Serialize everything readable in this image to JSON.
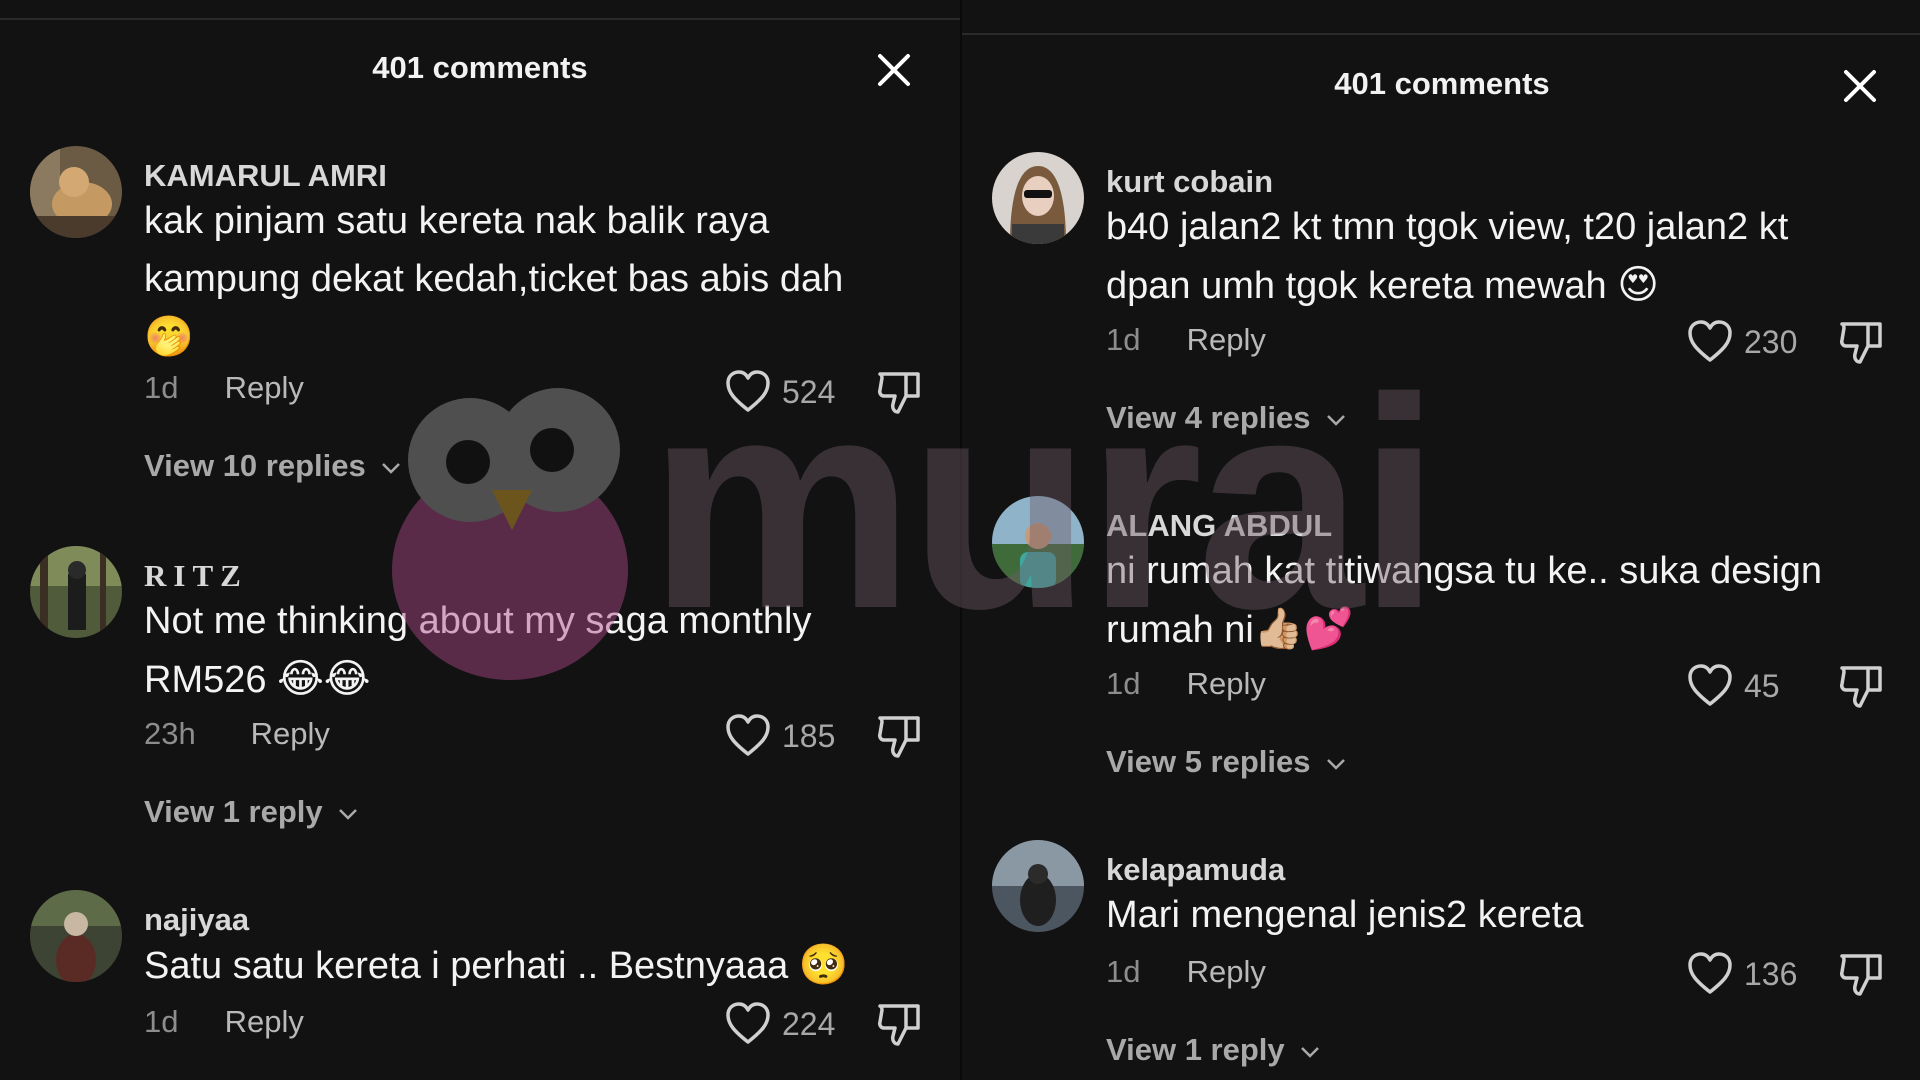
{
  "left_panel": {
    "title": "401 comments",
    "comments": [
      {
        "author": "KAMARUL AMRI",
        "text": "kak pinjam satu kereta nak balik raya kampung dekat kedah,ticket bas abis dah",
        "emoji": "🤭",
        "time": "1d",
        "reply": "Reply",
        "likes": "524",
        "view_replies": "View 10 replies"
      },
      {
        "author": "RITZ",
        "text": "Not me thinking about my saga monthly RM526",
        "emoji": "😂😂",
        "time": "23h",
        "reply": "Reply",
        "likes": "185",
        "view_replies": "View 1 reply"
      },
      {
        "author": "najiyaa",
        "text": "Satu satu kereta i perhati .. Bestnyaaa",
        "emoji": "🥺",
        "time": "1d",
        "reply": "Reply",
        "likes": "224"
      }
    ]
  },
  "right_panel": {
    "title": "401 comments",
    "comments": [
      {
        "author": "kurt cobain",
        "text": "b40 jalan2 kt tmn tgok view, t20 jalan2 kt dpan umh tgok kereta mewah",
        "emoji": "😍",
        "time": "1d",
        "reply": "Reply",
        "likes": "230",
        "view_replies": "View 4 replies"
      },
      {
        "author": "ALANG ABDUL",
        "text": "ni rumah kat titiwangsa tu ke.. suka design rumah ni",
        "emoji": "👍🏼💕",
        "time": "1d",
        "reply": "Reply",
        "likes": "45",
        "view_replies": "View 5 replies"
      },
      {
        "author": "kelapamuda",
        "text": "Mari mengenal jenis2 kereta",
        "emoji": "",
        "time": "1d",
        "reply": "Reply",
        "likes": "136",
        "view_replies": "View 1 reply"
      }
    ]
  },
  "watermark": {
    "text": "murai"
  },
  "icons": {
    "close": "close-icon",
    "like": "heart-outline-icon",
    "dislike": "thumbs-down-icon",
    "expand": "chevron-down-icon"
  },
  "colors": {
    "background": "#121212",
    "text_primary": "#f3f3f3",
    "text_secondary": "#8d8d8d",
    "watermark": "#6e5b66"
  }
}
